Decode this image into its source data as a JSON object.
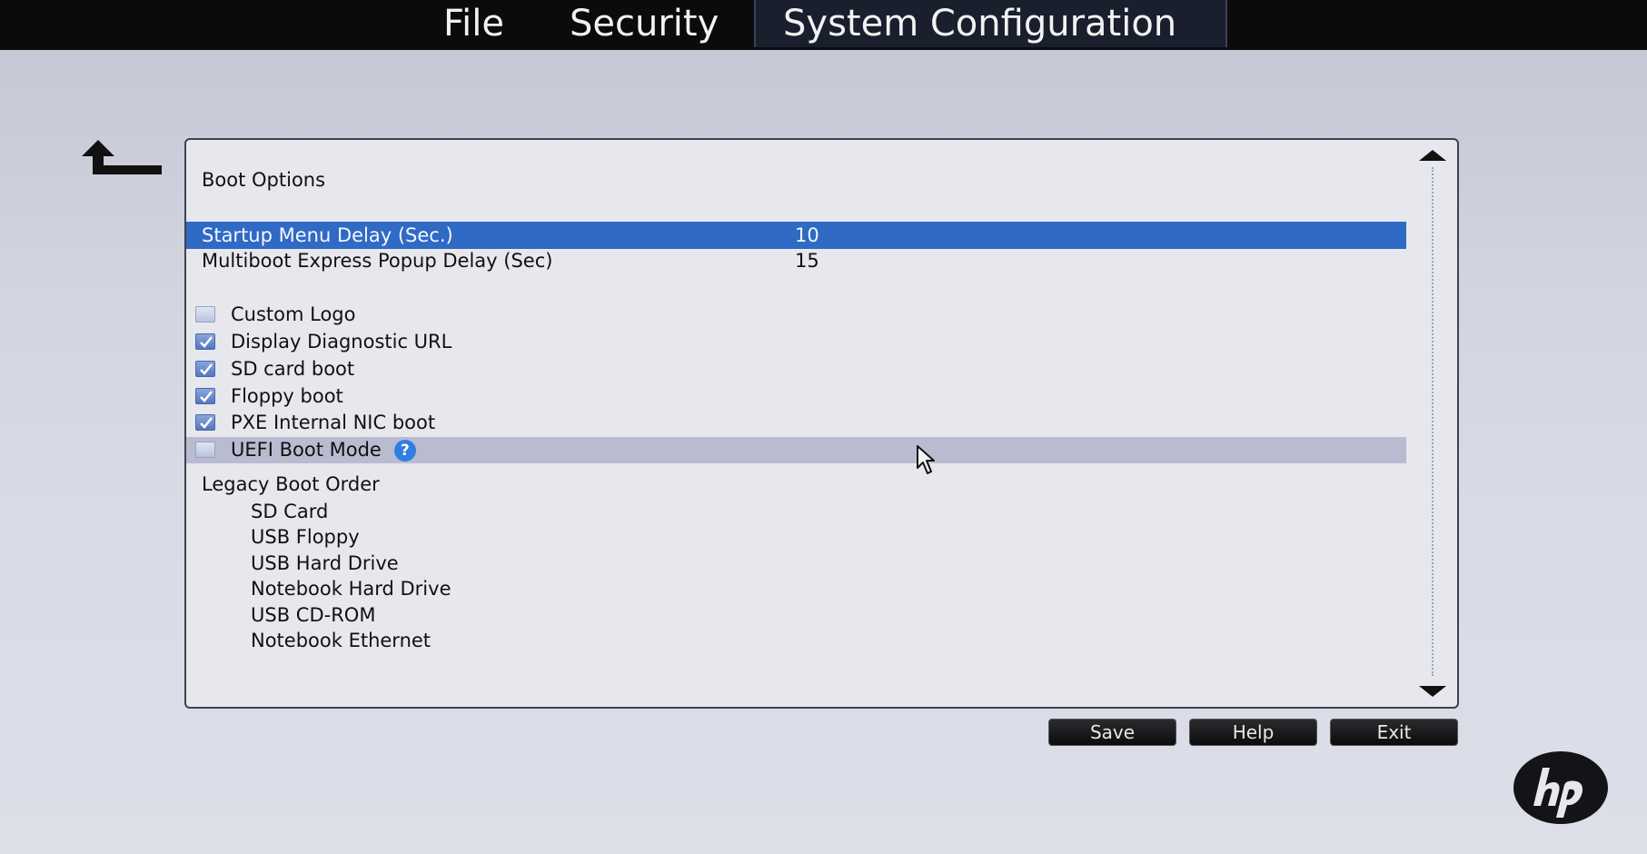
{
  "menu": {
    "tabs": [
      {
        "label": "File"
      },
      {
        "label": "Security"
      },
      {
        "label": "System Configuration",
        "active": true
      }
    ]
  },
  "icons": {
    "back": "back-arrow-icon",
    "help": "help-icon",
    "logo": "hp-logo"
  },
  "panel": {
    "section_title": "Boot Options",
    "settings": [
      {
        "label": "Startup Menu Delay (Sec.)",
        "value": "10",
        "selected": true
      },
      {
        "label": "Multiboot Express Popup Delay (Sec)",
        "value": "15",
        "selected": false
      }
    ],
    "checkboxes": [
      {
        "label": "Custom Logo",
        "checked": false
      },
      {
        "label": "Display Diagnostic URL",
        "checked": true
      },
      {
        "label": "SD card boot",
        "checked": true
      },
      {
        "label": "Floppy boot",
        "checked": true
      },
      {
        "label": "PXE Internal NIC boot",
        "checked": true
      },
      {
        "label": "UEFI Boot Mode",
        "checked": false,
        "help_glyph": "?"
      }
    ],
    "legacy_title": "Legacy Boot Order",
    "legacy_items": [
      "SD Card",
      "USB Floppy",
      "USB Hard Drive",
      "Notebook Hard Drive",
      "USB CD-ROM",
      "Notebook Ethernet"
    ]
  },
  "buttons": {
    "save": "Save",
    "help": "Help",
    "exit": "Exit"
  },
  "colors": {
    "selected_row": "#2f6ac4",
    "hover_row": "#b9bcd0",
    "menu_bar": "#0b0b0d",
    "checkbox_checked": "#5276c0"
  }
}
